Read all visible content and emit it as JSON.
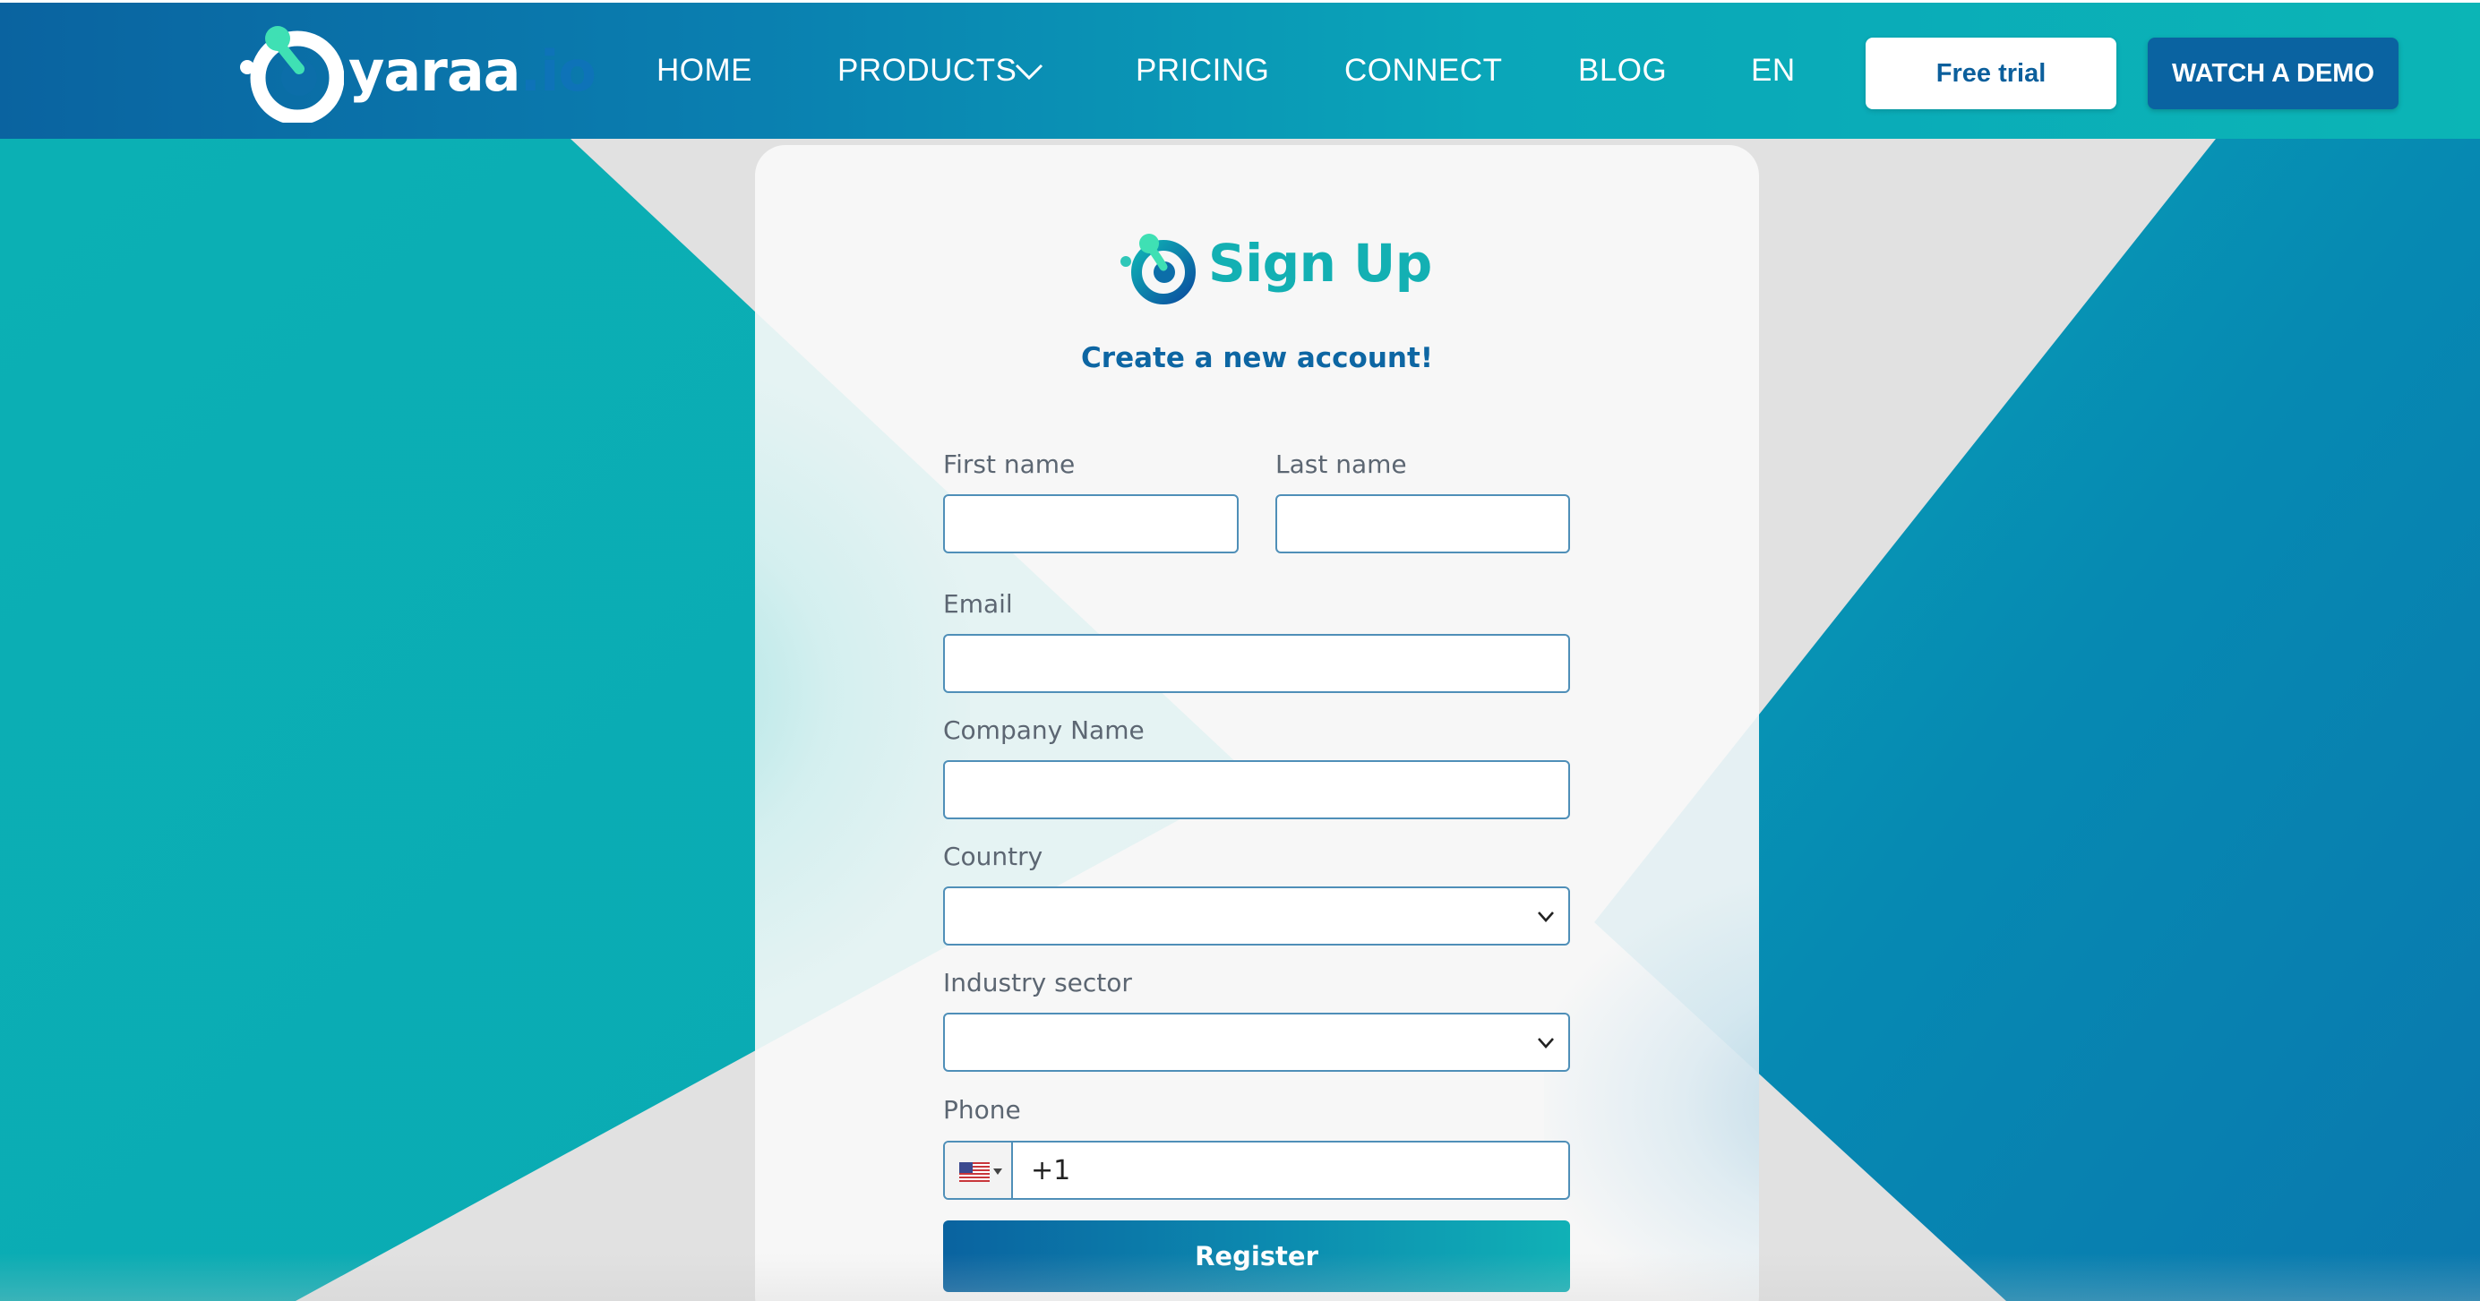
{
  "colors": {
    "brand_dark": "#0a63a1",
    "brand_teal": "#0bb5b6",
    "title_teal": "#13b0b3",
    "subtitle_blue": "#0d66a3",
    "input_border": "#4f8fb8"
  },
  "header": {
    "logo": {
      "name": "yaraa",
      "tld": ".io"
    },
    "nav": [
      {
        "label": "HOME"
      },
      {
        "label": "PRODUCTS",
        "has_dropdown": true
      },
      {
        "label": "PRICING"
      },
      {
        "label": "CONNECT"
      },
      {
        "label": "BLOG"
      },
      {
        "label": "EN"
      }
    ],
    "free_trial_label": "Free trial",
    "watch_demo_label": "WATCH A DEMO"
  },
  "form": {
    "title": "Sign Up",
    "subtitle": "Create a new account!",
    "fields": {
      "first_name": {
        "label": "First name",
        "value": ""
      },
      "last_name": {
        "label": "Last name",
        "value": ""
      },
      "email": {
        "label": "Email",
        "value": ""
      },
      "company": {
        "label": "Company Name",
        "value": ""
      },
      "country": {
        "label": "Country",
        "value": ""
      },
      "industry": {
        "label": "Industry sector",
        "value": ""
      },
      "phone": {
        "label": "Phone",
        "value": "+1",
        "flag": "us-flag-icon"
      }
    },
    "register_label": "Register"
  }
}
